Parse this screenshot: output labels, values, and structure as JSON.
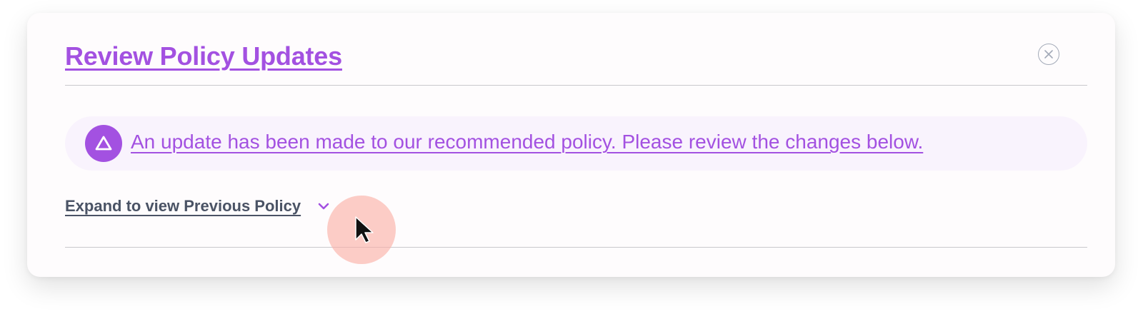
{
  "dialog": {
    "title": "Review Policy Updates",
    "close_icon": "close-icon"
  },
  "alert": {
    "icon": "warning-triangle-icon",
    "message": "An update has been made to our recommended policy. Please review the changes below."
  },
  "expand": {
    "label": "Expand to view Previous Policy",
    "icon": "chevron-down-icon"
  },
  "colors": {
    "accent": "#a351e1",
    "alert_bg": "#f9f3fd",
    "text_secondary": "#4a5365",
    "divider": "#c9c9cc",
    "cursor_highlight": "#faafa5"
  }
}
